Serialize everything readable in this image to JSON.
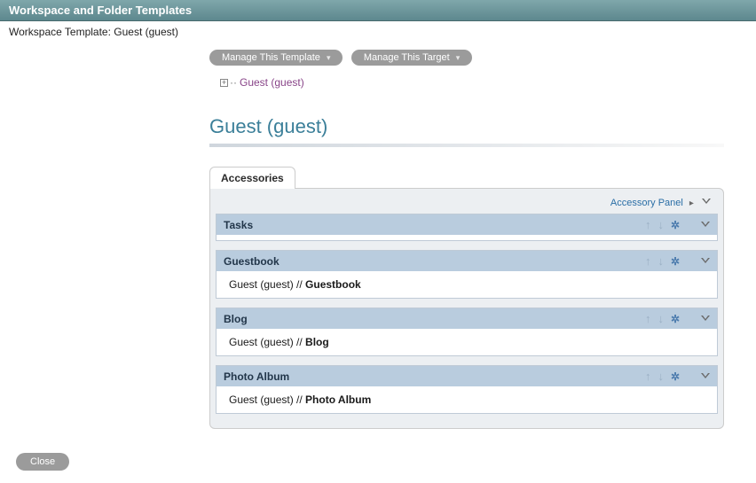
{
  "window": {
    "title": "Workspace and Folder Templates"
  },
  "subtitle": "Workspace Template: Guest (guest)",
  "buttons": {
    "manage_template": "Manage This Template",
    "manage_target": "Manage This Target"
  },
  "tree": {
    "node_label": "Guest (guest)"
  },
  "heading": "Guest (guest)",
  "tab": {
    "label": "Accessories"
  },
  "panel": {
    "accessory_link": "Accessory Panel",
    "sections": [
      {
        "title": "Tasks",
        "path_prefix": "",
        "path_item": ""
      },
      {
        "title": "Guestbook",
        "path_prefix": "Guest (guest) // ",
        "path_item": "Guestbook"
      },
      {
        "title": "Blog",
        "path_prefix": "Guest (guest) // ",
        "path_item": "Blog"
      },
      {
        "title": "Photo Album",
        "path_prefix": "Guest (guest) // ",
        "path_item": "Photo Album"
      }
    ]
  },
  "footer": {
    "close": "Close"
  }
}
